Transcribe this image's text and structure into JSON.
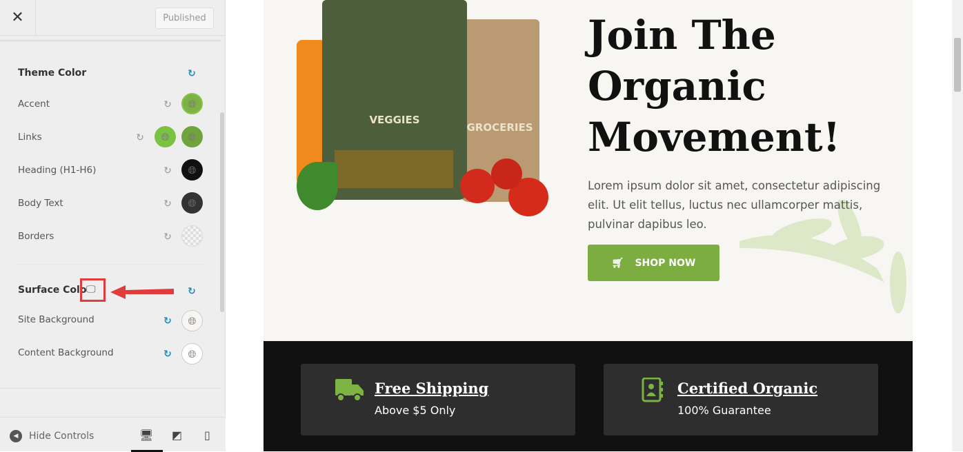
{
  "sidebar": {
    "close_label": "✕",
    "published_label": "Published",
    "theme_color": {
      "title": "Theme Color",
      "rows": [
        {
          "label": "Accent",
          "swatches": [
            "#7cb342"
          ]
        },
        {
          "label": "Links",
          "swatches": [
            "#7cc242",
            "#6ea43b"
          ]
        },
        {
          "label": "Heading (H1-H6)",
          "swatches": [
            "#111111"
          ]
        },
        {
          "label": "Body Text",
          "swatches": [
            "#333333"
          ]
        },
        {
          "label": "Borders",
          "swatches": [
            "transparent"
          ]
        }
      ]
    },
    "surface_color": {
      "title": "Surface Colo",
      "rows": [
        {
          "label": "Site Background",
          "swatches": [
            "#f7f6f3"
          ]
        },
        {
          "label": "Content Background",
          "swatches": [
            "#ffffff"
          ]
        }
      ]
    },
    "footer": {
      "hide_controls": "Hide Controls",
      "active_device": "desktop"
    }
  },
  "preview": {
    "hero": {
      "heading": "Join The Organic Movement!",
      "paragraph": "Lorem ipsum dolor sit amet, consectetur adipiscing elit. Ut elit tellus, luctus nec ullamcorper mattis, pulvinar dapibus leo.",
      "button": "SHOP NOW",
      "bag_labels": [
        "VEGGIES",
        "GROCERIES"
      ]
    },
    "features": [
      {
        "title": "Free Shipping",
        "subtitle": "Above $5 Only",
        "icon": "truck-icon"
      },
      {
        "title": "Certified Organic",
        "subtitle": "100% Guarantee",
        "icon": "contact-book-icon"
      }
    ]
  },
  "colors": {
    "accent": "#7cad41",
    "highlight": "#e23b3b",
    "reset_blue": "#1e8cbe"
  }
}
